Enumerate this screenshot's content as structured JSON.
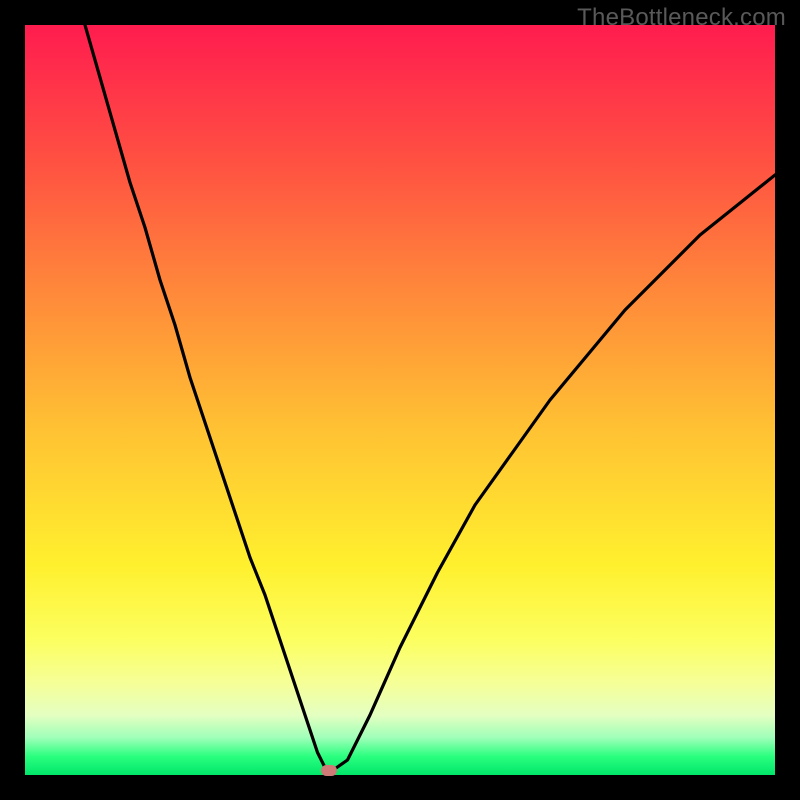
{
  "watermark": "TheBottleneck.com",
  "chart_data": {
    "type": "line",
    "title": "",
    "xlabel": "",
    "ylabel": "",
    "xlim": [
      0,
      100
    ],
    "ylim": [
      0,
      100
    ],
    "series": [
      {
        "name": "bottleneck-curve",
        "x": [
          8,
          10,
          12,
          14,
          16,
          18,
          20,
          22,
          24,
          26,
          28,
          30,
          32,
          34,
          36,
          38,
          39,
          40,
          41,
          43,
          46,
          50,
          55,
          60,
          65,
          70,
          75,
          80,
          85,
          90,
          95,
          100
        ],
        "y": [
          100,
          93,
          86,
          79,
          73,
          66,
          60,
          53,
          47,
          41,
          35,
          29,
          24,
          18,
          12,
          6,
          3,
          1,
          0.6,
          2,
          8,
          17,
          27,
          36,
          43,
          50,
          56,
          62,
          67,
          72,
          76,
          80
        ]
      }
    ],
    "marker": {
      "x": 40.5,
      "y": 0.6,
      "color": "#cf7a77"
    },
    "gradient_background": {
      "top": "#ff1c4f",
      "bottom": "#00e66a"
    },
    "note": "Values are estimated from pixel positions; axes have no visible ticks."
  },
  "colors": {
    "frame": "#000000",
    "curve": "#000000",
    "watermark": "#595959"
  }
}
